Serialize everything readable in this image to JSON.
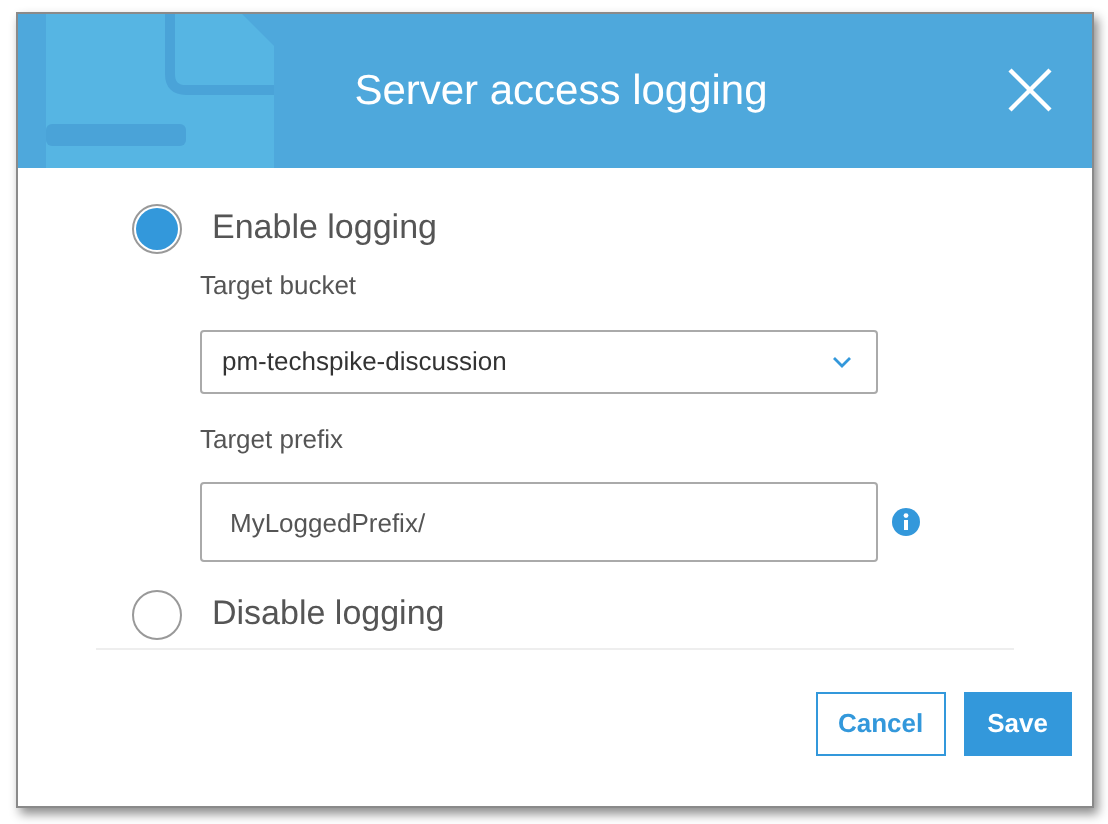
{
  "dialog": {
    "title": "Server access logging"
  },
  "options": [
    {
      "label": "Enable logging",
      "selected": true
    },
    {
      "label": "Disable logging",
      "selected": false
    }
  ],
  "fields": [
    {
      "kind": "select",
      "label": "Target bucket",
      "value": "pm-techspike-discussion"
    },
    {
      "kind": "text",
      "label": "Target prefix",
      "value": "MyLoggedPrefix/",
      "info": true
    }
  ],
  "buttons": [
    {
      "label": "Cancel",
      "kind": "secondary"
    },
    {
      "label": "Save",
      "kind": "primary"
    }
  ]
}
